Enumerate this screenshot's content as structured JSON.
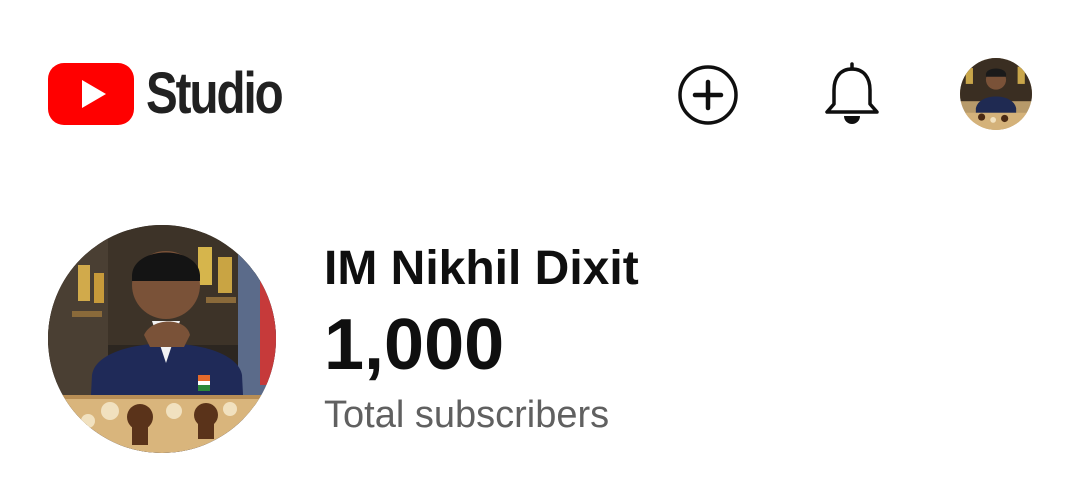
{
  "header": {
    "brand_name": "Studio",
    "brand_color": "#ff0000",
    "actions": {
      "create_icon": "plus-circle-icon",
      "notifications_icon": "bell-icon",
      "account_icon": "account-avatar"
    }
  },
  "channel": {
    "name": "IM Nikhil Dixit",
    "subscriber_count": "1,000",
    "subscriber_label": "Total subscribers"
  }
}
